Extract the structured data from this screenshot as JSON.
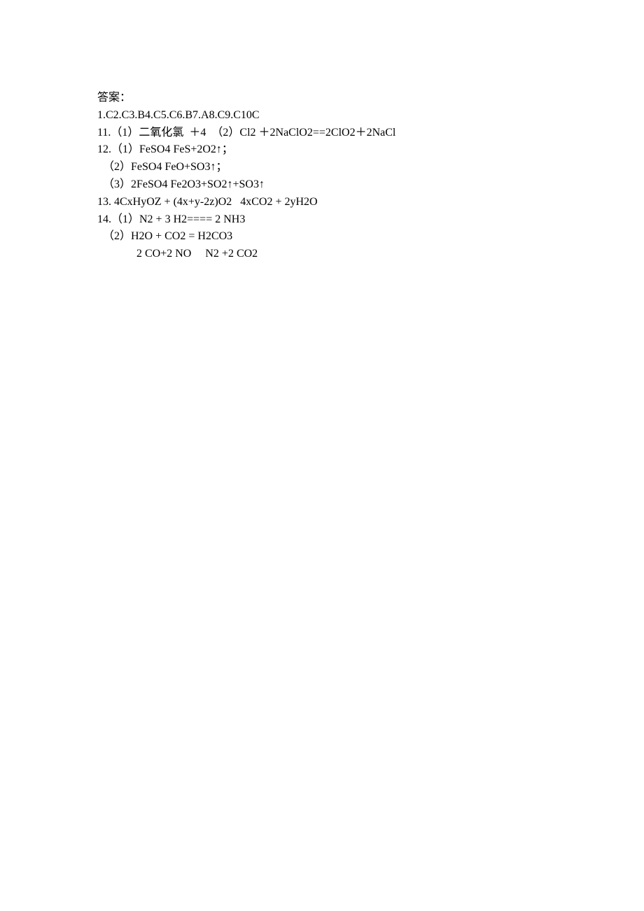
{
  "header": "答案：",
  "lines": {
    "l1": "1.C2.C3.B4.C5.C6.B7.A8.C9.C10C",
    "l2": "11.（1）二氧化氯  ＋4  （2）Cl2 ＋2NaClO2==2ClO2＋2NaCl",
    "l3": "12.（1）FeSO4 FeS+2O2↑；",
    "l4": "（2）FeSO4 FeO+SO3↑；",
    "l5": "（3）2FeSO4 Fe2O3+SO2↑+SO3↑",
    "l6": "13. 4CxHyOZ + (4x+y-2z)O2   4xCO2 + 2yH2O",
    "l7": "14.（1）N2 + 3 H2==== 2 NH3",
    "l8": "（2）H2O + CO2 = H2CO3",
    "l9": "2 CO+2 NO     N2 +2 CO2"
  }
}
